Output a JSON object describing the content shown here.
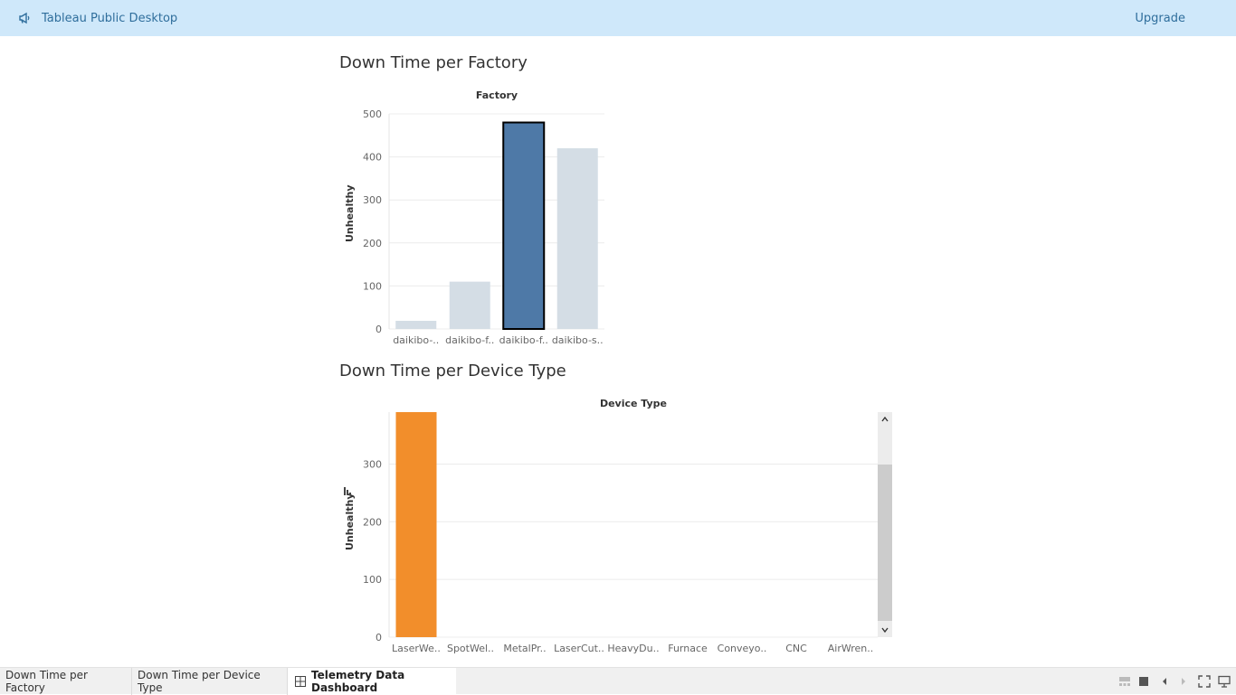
{
  "topbar": {
    "brand_icon": "megaphone-icon",
    "app_title": "Tableau Public Desktop",
    "upgrade_label": "Upgrade"
  },
  "colors": {
    "topbar_bg": "#cfe8fa",
    "selected_bar": "#4e79a7",
    "muted_bar": "#d4dde5",
    "device_bar": "#f28e2b"
  },
  "charts": {
    "factory_title": "Down Time per Factory",
    "device_title": "Down Time per Device Type"
  },
  "chart_data": [
    {
      "type": "bar",
      "title": "Down Time per Factory",
      "xlabel": "Factory",
      "ylabel": "Unhealthy",
      "categories": [
        "daikibo-..",
        "daikibo-f..",
        "daikibo-f..",
        "daikibo-s.."
      ],
      "values": [
        19,
        110,
        480,
        420
      ],
      "selected_index": 2,
      "ylim": [
        0,
        500
      ],
      "yticks": [
        0,
        100,
        200,
        300,
        400,
        500
      ],
      "grid": true
    },
    {
      "type": "bar",
      "title": "Down Time per Device Type",
      "xlabel": "Device Type",
      "ylabel": "Unhealthy",
      "categories": [
        "LaserWe..",
        "SpotWel..",
        "MetalPr..",
        "LaserCut..",
        "HeavyDu..",
        "Furnace",
        "Conveyo..",
        "CNC",
        "AirWren.."
      ],
      "values": [
        390,
        0,
        0,
        0,
        0,
        0,
        0,
        0,
        0
      ],
      "ylim": [
        0,
        390
      ],
      "yticks": [
        0,
        100,
        200,
        300
      ],
      "grid": true,
      "sort_icon": "sort-descending-icon"
    }
  ],
  "scrollbar": {
    "up_icon": "chevron-up-icon",
    "down_icon": "chevron-down-icon"
  },
  "tabs": [
    {
      "label": "Down Time per Factory",
      "active": false
    },
    {
      "label": "Down Time per Device Type",
      "active": false
    },
    {
      "label": "Telemetry Data Dashboard",
      "active": true,
      "icon": "dashboard-grid-icon"
    }
  ],
  "controls": {
    "icons": [
      "filmstrip-icon",
      "tab-view-icon",
      "previous-icon",
      "next-icon",
      "fullscreen-icon",
      "presentation-icon"
    ]
  }
}
